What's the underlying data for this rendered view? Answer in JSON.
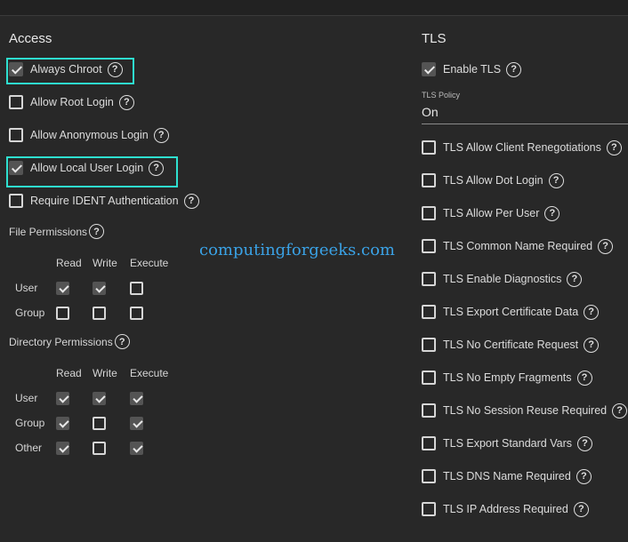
{
  "access": {
    "title": "Access",
    "options": [
      {
        "label": "Always Chroot",
        "checked": true
      },
      {
        "label": "Allow Root Login",
        "checked": false
      },
      {
        "label": "Allow Anonymous Login",
        "checked": false
      },
      {
        "label": "Allow Local User Login",
        "checked": true
      },
      {
        "label": "Require IDENT Authentication",
        "checked": false
      }
    ]
  },
  "help_glyph": "?",
  "file_permissions": {
    "title": "File Permissions",
    "columns": [
      "Read",
      "Write",
      "Execute"
    ],
    "rows": [
      {
        "label": "User",
        "values": [
          true,
          true,
          false
        ]
      },
      {
        "label": "Group",
        "values": [
          false,
          false,
          false
        ]
      }
    ]
  },
  "directory_permissions": {
    "title": "Directory Permissions",
    "columns": [
      "Read",
      "Write",
      "Execute"
    ],
    "rows": [
      {
        "label": "User",
        "values": [
          true,
          true,
          true
        ]
      },
      {
        "label": "Group",
        "values": [
          true,
          false,
          true
        ]
      },
      {
        "label": "Other",
        "values": [
          true,
          false,
          true
        ]
      }
    ]
  },
  "tls": {
    "title": "TLS",
    "enable": {
      "label": "Enable TLS",
      "checked": true
    },
    "policy": {
      "label": "TLS Policy",
      "value": "On"
    },
    "options": [
      {
        "label": "TLS Allow Client Renegotiations",
        "checked": false
      },
      {
        "label": "TLS Allow Dot Login",
        "checked": false
      },
      {
        "label": "TLS Allow Per User",
        "checked": false
      },
      {
        "label": "TLS Common Name Required",
        "checked": false
      },
      {
        "label": "TLS Enable Diagnostics",
        "checked": false
      },
      {
        "label": "TLS Export Certificate Data",
        "checked": false
      },
      {
        "label": "TLS No Certificate Request",
        "checked": false
      },
      {
        "label": "TLS No Empty Fragments",
        "checked": false
      },
      {
        "label": "TLS No Session Reuse Required",
        "checked": false
      },
      {
        "label": "TLS Export Standard Vars",
        "checked": false
      },
      {
        "label": "TLS DNS Name Required",
        "checked": false
      },
      {
        "label": "TLS IP Address Required",
        "checked": false
      }
    ]
  },
  "watermark": "computingforgeeks.com",
  "colors": {
    "highlight": "#2ee0d0",
    "background": "#282828",
    "watermark": "#3aa2e6"
  }
}
